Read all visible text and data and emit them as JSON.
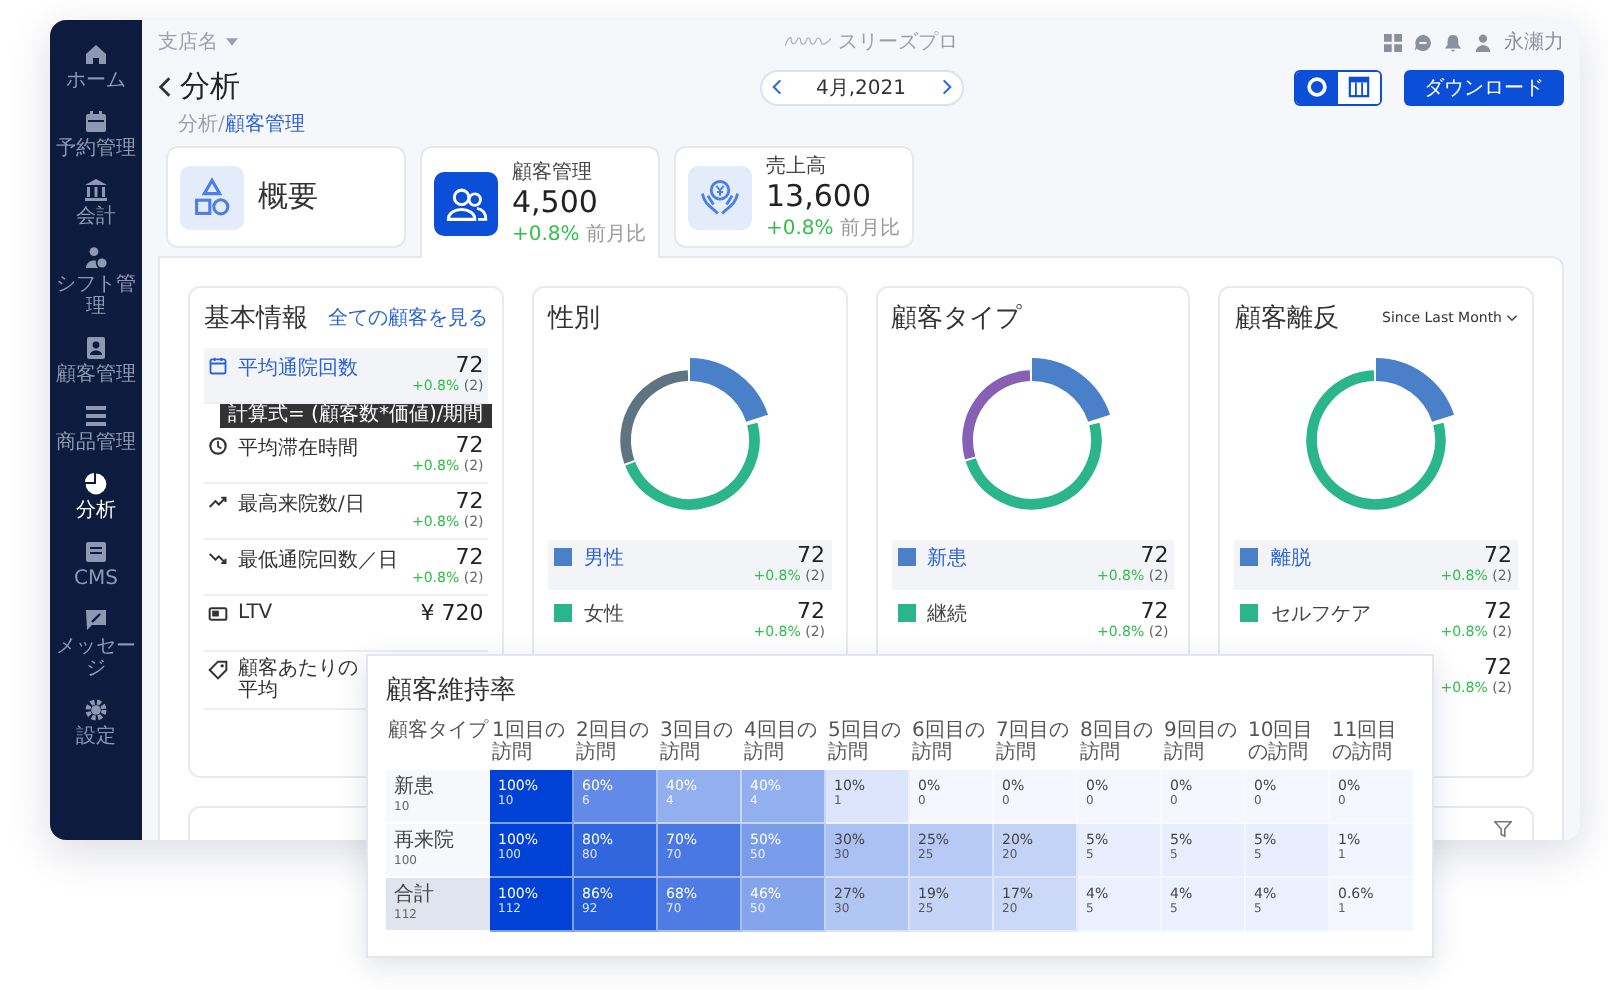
{
  "sidebar": {
    "items": [
      {
        "label": "ホーム",
        "selected": false
      },
      {
        "label": "予約管理",
        "selected": false
      },
      {
        "label": "会計",
        "selected": false
      },
      {
        "label": "シフト管理",
        "selected": false
      },
      {
        "label": "顧客管理",
        "selected": false
      },
      {
        "label": "商品管理",
        "selected": false
      },
      {
        "label": "分析",
        "selected": true
      },
      {
        "label": "CMS",
        "selected": false
      },
      {
        "label": "メッセージ",
        "selected": false
      },
      {
        "label": "設定",
        "selected": false
      }
    ]
  },
  "topbar": {
    "shop": "支店名",
    "brand": "スリーズプロ",
    "user": "永瀬力"
  },
  "header": {
    "title": "分析",
    "date": "4月,2021",
    "download": "ダウンロード",
    "view_toggle": [
      {
        "kind": "donut",
        "selected": true
      },
      {
        "kind": "table",
        "selected": false
      }
    ]
  },
  "breadcrumb": [
    {
      "label": "分析/",
      "current": false
    },
    {
      "label": "顧客管理",
      "current": true
    }
  ],
  "tabs": [
    {
      "kind": "plain",
      "label": "概要",
      "selected": false
    },
    {
      "kind": "stat",
      "label": "顧客管理",
      "value": "4,500",
      "change": "+0.8%",
      "note": "前月比",
      "selected": true
    },
    {
      "kind": "stat",
      "label": "売上高",
      "value": "13,600",
      "change": "+0.8%",
      "note": "前月比",
      "selected": false
    }
  ],
  "basic_info": {
    "title": "基本情報",
    "link": "全ての顧客を見る",
    "tooltip": "計算式= (顧客数*価値)/期間",
    "items": [
      {
        "label": "平均通院回数",
        "value": "72",
        "change": "+0.8%",
        "count": "(2)",
        "selected": true
      },
      {
        "label": "平均滞在時間",
        "value": "72",
        "change": "+0.8%",
        "count": "(2)",
        "selected": false
      },
      {
        "label": "最高来院数/日",
        "value": "72",
        "change": "+0.8%",
        "count": "(2)",
        "selected": false
      },
      {
        "label": "最低通院回数／日",
        "value": "72",
        "change": "+0.8%",
        "count": "(2)",
        "selected": false
      },
      {
        "label": "LTV",
        "value": "¥ 720",
        "selected": false
      },
      {
        "label": "顧客あたりの平均",
        "selected": false
      }
    ]
  },
  "charts": [
    {
      "title": "性別",
      "legend": [
        {
          "label": "男性",
          "color": "#4a80c8",
          "value": "72",
          "change": "+0.8%",
          "count": "(2)",
          "selected": true
        },
        {
          "label": "女性",
          "color": "#2bb58a",
          "value": "72",
          "change": "+0.8%",
          "count": "(2)",
          "selected": false
        }
      ]
    },
    {
      "title": "顧客タイプ",
      "legend": [
        {
          "label": "新患",
          "color": "#4a80c8",
          "value": "72",
          "change": "+0.8%",
          "count": "(2)",
          "selected": true
        },
        {
          "label": "継続",
          "color": "#2bb58a",
          "value": "72",
          "change": "+0.8%",
          "count": "(2)",
          "selected": false
        }
      ]
    },
    {
      "title": "顧客離反",
      "period": "Since Last Month",
      "legend": [
        {
          "label": "離脱",
          "color": "#4a80c8",
          "value": "72",
          "change": "+0.8%",
          "count": "(2)",
          "selected": true
        },
        {
          "label": "セルフケア",
          "color": "#2bb58a",
          "value": "72",
          "change": "+0.8%",
          "count": "(2)",
          "selected": false
        },
        {
          "value": "72",
          "change": "+0.8%",
          "count": "(2)",
          "selected": false
        }
      ]
    }
  ],
  "retention": {
    "title": "顧客維持率",
    "columns": [
      "顧客タイプ",
      "1回目の訪問",
      "2回目の訪問",
      "3回目の訪問",
      "4回目の訪問",
      "5回目の訪問",
      "6回目の訪問",
      "7回目の訪問",
      "8回目の訪問",
      "9回目の訪問",
      "10回目の訪問",
      "11回目の訪問"
    ],
    "rows": [
      {
        "kind": "group",
        "cells": [
          {
            "label": "新患",
            "total": "10"
          },
          {
            "percent": "100%",
            "count": "10",
            "color": "#0042d6"
          },
          {
            "percent": "60%",
            "count": "6",
            "color": "#628ae6"
          },
          {
            "percent": "40%",
            "count": "4",
            "color": "#92afef"
          },
          {
            "percent": "40%",
            "count": "4",
            "color": "#92afef"
          },
          {
            "percent": "10%",
            "count": "1",
            "color": "#dce5fb"
          },
          {
            "percent": "0%",
            "count": "0",
            "color": "#f4f7ff"
          },
          {
            "percent": "0%",
            "count": "0",
            "color": "#f4f7ff"
          },
          {
            "percent": "0%",
            "count": "0",
            "color": "#f4f7ff"
          },
          {
            "percent": "0%",
            "count": "0",
            "color": "#f4f7ff"
          },
          {
            "percent": "0%",
            "count": "0",
            "color": "#f4f7ff"
          },
          {
            "percent": "0%",
            "count": "0",
            "color": "#f4f7ff"
          }
        ]
      },
      {
        "kind": "group",
        "cells": [
          {
            "label": "再来院",
            "total": "100"
          },
          {
            "percent": "100%",
            "count": "100",
            "color": "#0042d6"
          },
          {
            "percent": "80%",
            "count": "80",
            "color": "#3166de"
          },
          {
            "percent": "70%",
            "count": "70",
            "color": "#4978e2"
          },
          {
            "percent": "50%",
            "count": "50",
            "color": "#7a9deb"
          },
          {
            "percent": "30%",
            "count": "30",
            "color": "#abc1f3"
          },
          {
            "percent": "25%",
            "count": "25",
            "color": "#b7caf5"
          },
          {
            "percent": "20%",
            "count": "20",
            "color": "#c3d3f7"
          },
          {
            "percent": "5%",
            "count": "5",
            "color": "#e8eefd"
          },
          {
            "percent": "5%",
            "count": "5",
            "color": "#e8eefd"
          },
          {
            "percent": "5%",
            "count": "5",
            "color": "#e8eefd"
          },
          {
            "percent": "1%",
            "count": "1",
            "color": "#f2f5ff"
          }
        ]
      },
      {
        "kind": "total",
        "cells": [
          {
            "label": "合計",
            "total": "112"
          },
          {
            "percent": "100%",
            "count": "112",
            "color": "#0042d6"
          },
          {
            "percent": "86%",
            "count": "92",
            "color": "#225bdc"
          },
          {
            "percent": "68%",
            "count": "70",
            "color": "#4e7ce3"
          },
          {
            "percent": "46%",
            "count": "50",
            "color": "#84a4ec"
          },
          {
            "percent": "27%",
            "count": "30",
            "color": "#b2c6f4"
          },
          {
            "percent": "19%",
            "count": "25",
            "color": "#c6d5f7"
          },
          {
            "percent": "17%",
            "count": "20",
            "color": "#cbd8f8"
          },
          {
            "percent": "4%",
            "count": "5",
            "color": "#eaf0fd"
          },
          {
            "percent": "4%",
            "count": "5",
            "color": "#eaf0fd"
          },
          {
            "percent": "4%",
            "count": "5",
            "color": "#eaf0fd"
          },
          {
            "percent": "0.6%",
            "count": "1",
            "color": "#f3f6ff"
          }
        ]
      }
    ]
  }
}
